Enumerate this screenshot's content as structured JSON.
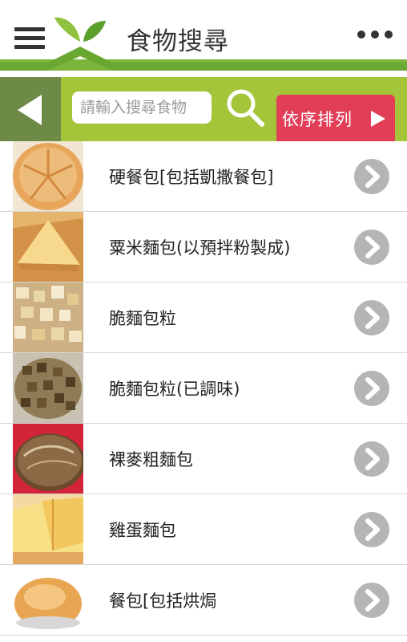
{
  "header": {
    "title": "食物搜尋"
  },
  "toolbar": {
    "search_placeholder": "請輸入搜尋食物",
    "sort_label": "依序排列"
  },
  "list": {
    "items": [
      {
        "name": "硬餐包[包括凱撒餐包]",
        "thumb": "kaiser-roll"
      },
      {
        "name": "粟米麵包(以預拌粉製成)",
        "thumb": "cornbread"
      },
      {
        "name": "脆麵包粒",
        "thumb": "croutons-plain"
      },
      {
        "name": "脆麵包粒(已調味)",
        "thumb": "croutons-seasoned"
      },
      {
        "name": "裸麥粗麵包",
        "thumb": "rye-loaf"
      },
      {
        "name": "雞蛋麵包",
        "thumb": "egg-bread"
      },
      {
        "name": "餐包[包括烘焗",
        "thumb": "dinner-roll"
      }
    ]
  },
  "colors": {
    "toolbar_green": "#a4c43a",
    "back_button": "#6e8a47",
    "sort_button": "#e23e58",
    "chevron_gray": "#b5b5b5"
  }
}
